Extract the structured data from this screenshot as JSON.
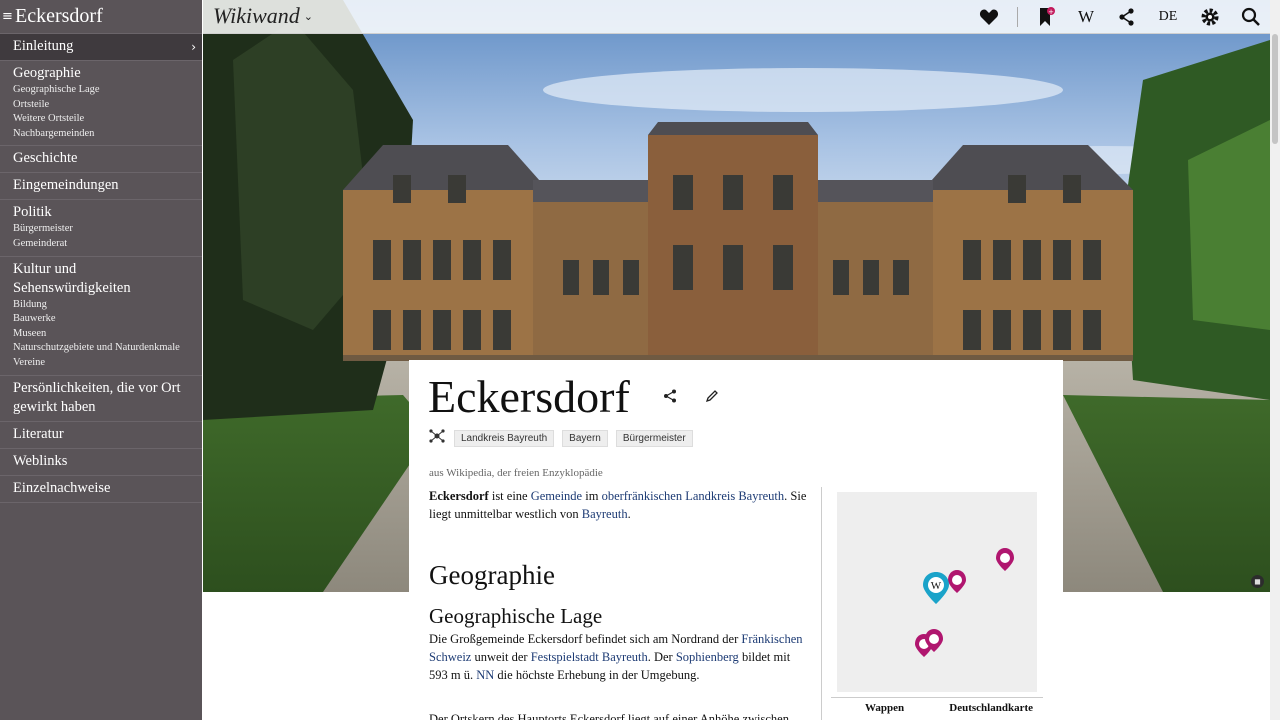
{
  "sidebar": {
    "title": "Eckersdorf",
    "menu_glyph": "≡",
    "items": [
      {
        "label": "Einleitung",
        "active": true,
        "subs": []
      },
      {
        "label": "Geographie",
        "subs": [
          "Geographische Lage",
          "Ortsteile",
          "Weitere Ortsteile",
          "Nachbargemeinden"
        ]
      },
      {
        "label": "Geschichte",
        "subs": []
      },
      {
        "label": "Eingemeindungen",
        "subs": []
      },
      {
        "label": "Politik",
        "subs": [
          "Bürgermeister",
          "Gemeinderat"
        ]
      },
      {
        "label": "Kultur und Sehenswürdigkeiten",
        "subs": [
          "Bildung",
          "Bauwerke",
          "Museen",
          "Naturschutzgebiete und Naturdenkmale",
          "Vereine"
        ]
      },
      {
        "label": "Persönlichkeiten, die vor Ort gewirkt haben",
        "subs": []
      },
      {
        "label": "Literatur",
        "subs": []
      },
      {
        "label": "Weblinks",
        "subs": []
      },
      {
        "label": "Einzelnachweise",
        "subs": []
      }
    ]
  },
  "topbar": {
    "brand": "Wikiwand",
    "wikipedia_letter": "W",
    "language": "DE"
  },
  "article": {
    "title": "Eckersdorf",
    "tags": [
      "Landkreis Bayreuth",
      "Bayern",
      "Bürgermeister"
    ],
    "source": "aus Wikipedia, der freien Enzyklopädie",
    "intro": {
      "bold": "Eckersdorf",
      "t1": " ist eine ",
      "l1": "Gemeinde",
      "t2": " im ",
      "l2": "oberfränkischen",
      "t3": " ",
      "l3": "Landkreis Bayreuth",
      "t4": ". Sie liegt unmittelbar westlich von ",
      "l4": "Bayreuth",
      "t5": "."
    },
    "h2": "Geographie",
    "h3": "Geographische Lage",
    "lage": {
      "t1": "Die Großgemeinde Eckersdorf befindet sich am Nordrand der ",
      "l1": "Fränkischen Schweiz",
      "t2": " unweit der ",
      "l2": "Festspielstadt Bayreuth",
      "t3": ". Der ",
      "l3": "Sophienberg",
      "t4": " bildet mit 593 m ü. ",
      "l4": "NN",
      "t5": " die höchste Erhebung in der Umgebung."
    },
    "cut_line": "Der Ortskern des Hauptorts Eckersdorf liegt auf einer Anhöhe zwischen"
  },
  "infobox": {
    "map_pin_letter": "W",
    "caption_left": "Wappen",
    "caption_right": "Deutschlandkarte"
  },
  "colors": {
    "sidebar_bg": "#5a5458",
    "sidebar_active": "#3f3a3e",
    "link": "#1d3b74",
    "pin_magenta": "#b0166f",
    "pin_blue": "#1aa3c9"
  }
}
